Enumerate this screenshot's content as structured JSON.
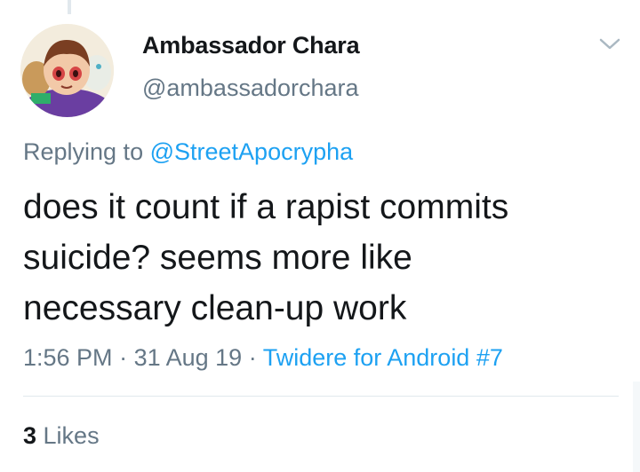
{
  "author": {
    "display_name": "Ambassador Chara",
    "handle": "@ambassadorchara"
  },
  "reply": {
    "prefix": "Replying to ",
    "mention": "@StreetApocrypha"
  },
  "tweet": {
    "lines": [
      "does it count if a rapist commits",
      "suicide? seems more like",
      "necessary clean-up work"
    ]
  },
  "meta": {
    "time": "1:56 PM",
    "sep1": " · ",
    "date": "31 Aug 19",
    "sep2": " · ",
    "source": "Twidere for Android #7"
  },
  "stats": {
    "likes_count": "3",
    "likes_label": " Likes"
  },
  "icons": {
    "menu": "chevron-down-icon"
  },
  "colors": {
    "text": "#14171a",
    "secondary": "#657786",
    "link": "#1da1f2",
    "divider": "#e1e8ed"
  }
}
